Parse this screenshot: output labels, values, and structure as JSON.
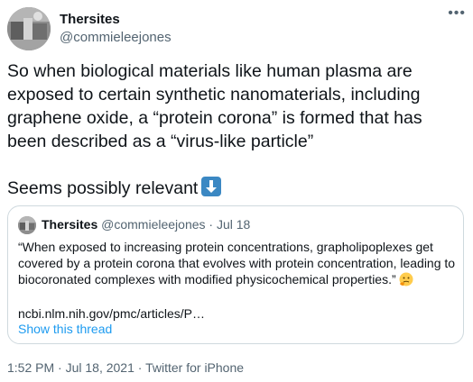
{
  "author": {
    "name": "Thersites",
    "handle": "@commieleejones",
    "avatar_icon": "avatar-image"
  },
  "more_icon": "more-options-icon",
  "tweet": {
    "paragraph1": "So when biological materials like human plasma are exposed to certain synthetic nanomaterials, including graphene oxide, a “protein corona” is formed that has been described as a “virus-like particle”",
    "paragraph2": "Seems possibly relevant",
    "emoji": "down-arrow-icon"
  },
  "quote": {
    "name": "Thersites",
    "handle": "@commieleejones",
    "separator": "·",
    "date": "Jul 18",
    "text": "“When exposed to increasing protein concentrations, grapholipoplexes get covered by a protein corona that evolves with protein concentration, leading to biocoronated complexes with modified physicochemical properties.”",
    "emoji": "thinking-face-icon",
    "link": "ncbi.nlm.nih.gov/pmc/articles/P…",
    "show_thread": "Show this thread"
  },
  "footer": {
    "time": "1:52 PM",
    "separator": "·",
    "date": "Jul 18, 2021",
    "separator2": "·",
    "client": "Twitter for iPhone"
  },
  "colors": {
    "text": "#0f1419",
    "secondary": "#536471",
    "link": "#1d9bf0",
    "border": "#cfd9de",
    "emoji_blue": "#3b88c3"
  }
}
